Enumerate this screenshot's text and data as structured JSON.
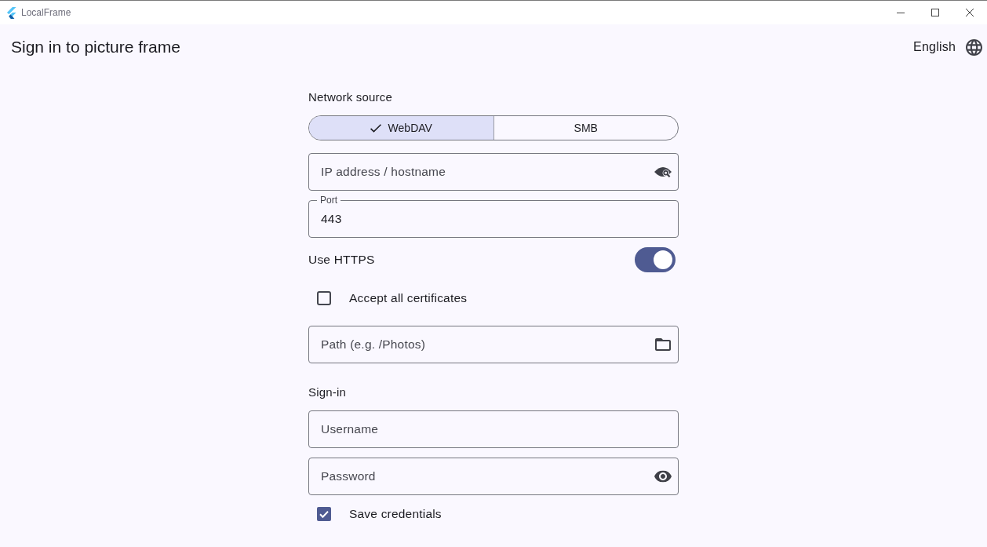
{
  "window": {
    "title": "LocalFrame"
  },
  "header": {
    "title": "Sign in to picture frame",
    "language": "English"
  },
  "network": {
    "heading": "Network source",
    "source_options": [
      {
        "label": "WebDAV",
        "selected": true
      },
      {
        "label": "SMB",
        "selected": false
      }
    ],
    "host_field": {
      "placeholder": "IP address / hostname"
    },
    "port_field": {
      "label": "Port",
      "value": "443"
    },
    "use_https": {
      "label": "Use HTTPS",
      "on": true
    },
    "accept_certificates": {
      "label": "Accept all certificates",
      "checked": false
    },
    "path_field": {
      "placeholder": "Path (e.g. /Photos)"
    }
  },
  "sign_in": {
    "heading": "Sign-in",
    "username_field": {
      "placeholder": "Username"
    },
    "password_field": {
      "placeholder": "Password"
    },
    "save_credentials": {
      "label": "Save credentials",
      "checked": true
    }
  }
}
